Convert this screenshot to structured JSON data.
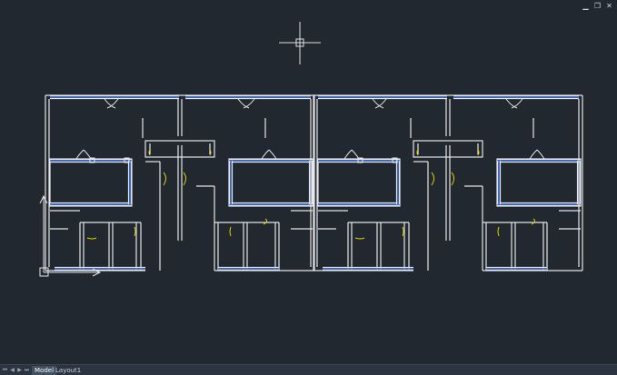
{
  "window": {
    "controls": [
      {
        "name": "minimize",
        "glyph": "▁"
      },
      {
        "name": "restore",
        "glyph": "❐"
      },
      {
        "name": "close",
        "glyph": "✕"
      }
    ]
  },
  "layout_tabs": {
    "nav_glyphs": [
      "⏮",
      "◀",
      "▶",
      "⏭"
    ],
    "tabs": [
      {
        "label": "Model",
        "active": true
      },
      {
        "label": "Layout1",
        "active": false
      }
    ]
  },
  "colors": {
    "background": "#212830",
    "wall": "#e6e6e6",
    "window": "#3f6fd6",
    "door_swing": "#e8d000",
    "crosshair": "#e0e0e0"
  },
  "icons": [
    "ucs-icon",
    "crosshair-cursor-icon"
  ]
}
